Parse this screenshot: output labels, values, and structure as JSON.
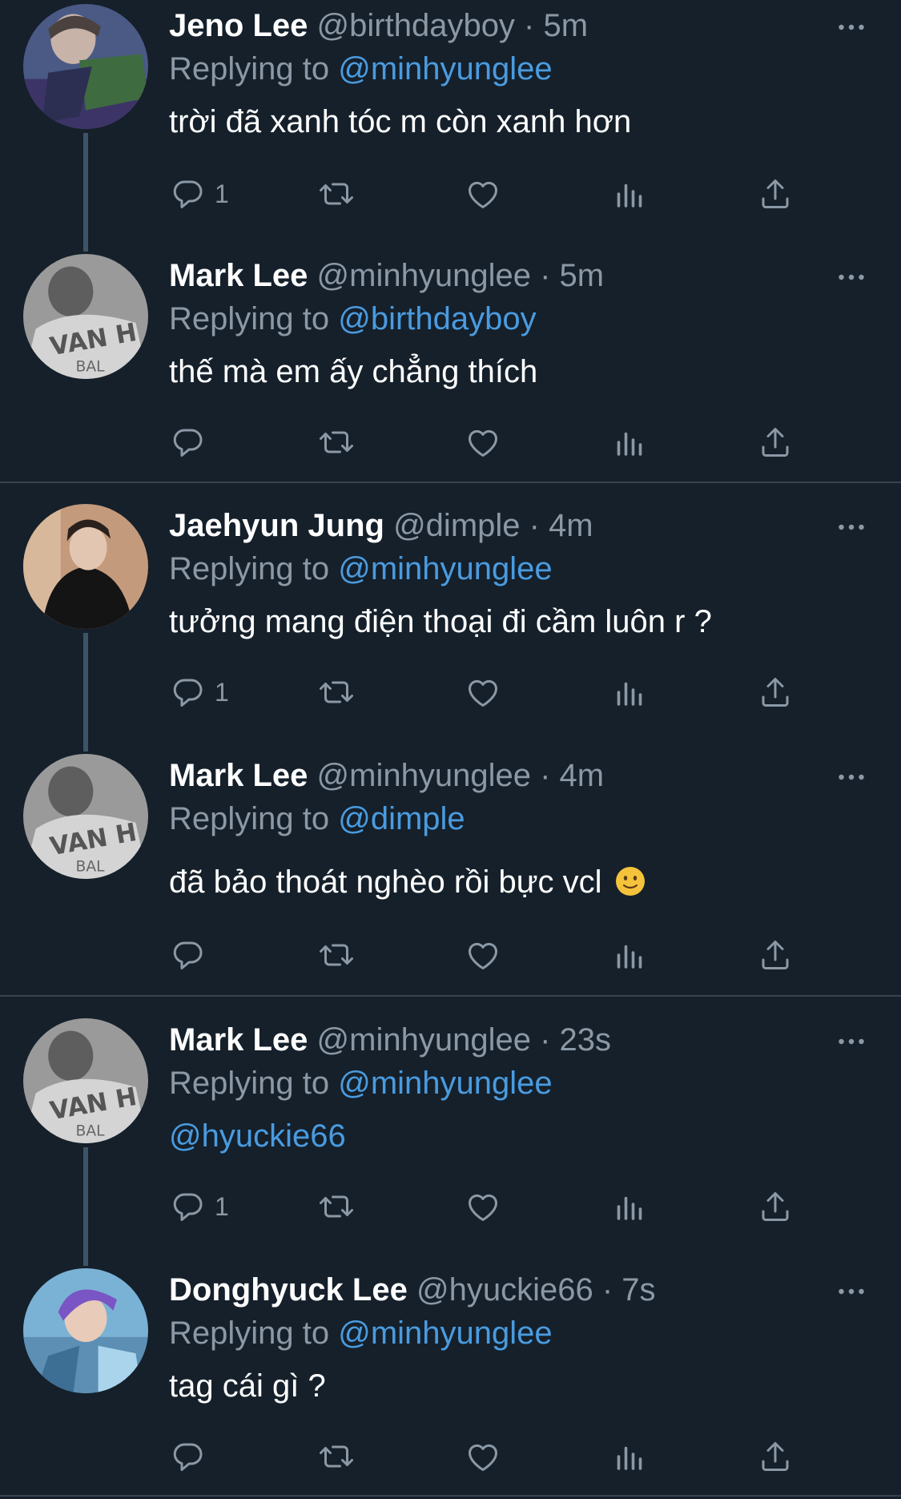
{
  "tweets": [
    {
      "name": "Jeno Lee",
      "handle": "@birthdayboy",
      "time": "5m",
      "replying_prefix": "Replying to ",
      "replying_to": "@minhyunglee",
      "text": "trời đã xanh tóc m còn xanh hơn",
      "reply_count": "1"
    },
    {
      "name": "Mark Lee",
      "handle": "@minhyunglee",
      "time": "5m",
      "replying_prefix": "Replying to ",
      "replying_to": "@birthdayboy",
      "text": "thế mà em ấy chẳng thích",
      "reply_count": ""
    },
    {
      "name": "Jaehyun Jung",
      "handle": "@dimple",
      "time": "4m",
      "replying_prefix": "Replying to ",
      "replying_to": "@minhyunglee",
      "text": "tưởng mang điện thoại đi cầm luôn r ?",
      "reply_count": "1"
    },
    {
      "name": "Mark Lee",
      "handle": "@minhyunglee",
      "time": "4m",
      "replying_prefix": "Replying to ",
      "replying_to": "@dimple",
      "text": "đã bảo thoát nghèo rồi bực vcl",
      "emoji": "slightly-smiling-face",
      "reply_count": ""
    },
    {
      "name": "Mark Lee",
      "handle": "@minhyunglee",
      "time": "23s",
      "replying_prefix": "Replying to ",
      "replying_to": "@minhyunglee",
      "text": "@hyuckie66",
      "reply_count": "1"
    },
    {
      "name": "Donghyuck Lee",
      "handle": "@hyuckie66",
      "time": "7s",
      "replying_prefix": "Replying to ",
      "replying_to": "@minhyunglee",
      "text": "tag cái gì ?",
      "reply_count": ""
    }
  ],
  "separator": " · ",
  "icons": [
    "reply-icon",
    "retweet-icon",
    "like-icon",
    "analytics-icon",
    "share-icon",
    "more-icon"
  ],
  "colors": {
    "background": "#15202b",
    "muted": "#8b98a5",
    "link": "#4a9bdf",
    "divider": "#38444d"
  }
}
